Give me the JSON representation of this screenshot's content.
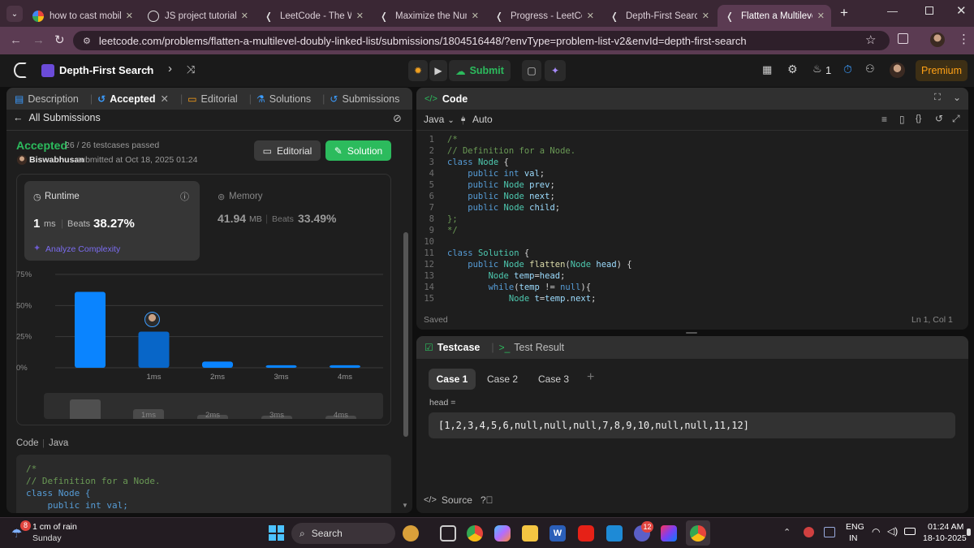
{
  "browser": {
    "tabs": [
      {
        "title": "how to cast mobile sc",
        "favicon": "google-icon"
      },
      {
        "title": "JS project tutorial",
        "favicon": "chatgpt-icon"
      },
      {
        "title": "LeetCode - The World",
        "favicon": "leetcode-icon"
      },
      {
        "title": "Maximize the Numbe",
        "favicon": "leetcode-icon"
      },
      {
        "title": "Progress - LeetCode",
        "favicon": "leetcode-icon"
      },
      {
        "title": "Depth-First Search -",
        "favicon": "leetcode-icon"
      },
      {
        "title": "Flatten a Multilevel D",
        "favicon": "leetcode-icon",
        "active": true
      }
    ],
    "url": "leetcode.com/problems/flatten-a-multilevel-doubly-linked-list/submissions/1804516448/?envType=problem-list-v2&envId=depth-first-search"
  },
  "nav": {
    "list_title": "Depth-First Search",
    "submit_label": "Submit",
    "streak": "1",
    "premium_label": "Premium"
  },
  "left_panel": {
    "tabs": [
      "Description",
      "Accepted",
      "Editorial",
      "Solutions",
      "Submissions"
    ],
    "back_label": "All Submissions",
    "status": "Accepted",
    "testcases": "26 / 26 testcases passed",
    "user": "Biswabhusan",
    "submitted": "submitted at Oct 18, 2025 01:24",
    "editorial_btn": "Editorial",
    "solution_btn": "Solution",
    "runtime_label": "Runtime",
    "runtime_value": "1",
    "runtime_unit": "ms",
    "beats_label": "Beats",
    "runtime_beats": "38.27%",
    "analyze_label": "Analyze Complexity",
    "memory_label": "Memory",
    "memory_value": "41.94",
    "memory_unit": "MB",
    "memory_beats": "33.49%",
    "code_label": "Code",
    "lang_label": "Java",
    "code_preview": [
      "/*",
      "// Definition for a Node.",
      "class Node {",
      "    public int val;"
    ]
  },
  "chart_data": {
    "type": "bar",
    "categories": [
      "",
      "1ms",
      "2ms",
      "3ms",
      "4ms"
    ],
    "values": [
      61,
      29,
      5,
      2,
      2
    ],
    "ylim": [
      0,
      75
    ],
    "yticks": [
      "0%",
      "25%",
      "50%",
      "75%"
    ],
    "highlight_index": 1,
    "colors": {
      "bar": "#0a84ff",
      "highlight": "#0866c8"
    }
  },
  "editor": {
    "title": "Code",
    "lang": "Java",
    "mode": "Auto",
    "saved": "Saved",
    "cursor": "Ln 1, Col 1"
  },
  "testcase": {
    "title": "Testcase",
    "result_tab": "Test Result",
    "cases": [
      "Case 1",
      "Case 2",
      "Case 3"
    ],
    "param_label": "head =",
    "param_value": "[1,2,3,4,5,6,null,null,null,7,8,9,10,null,null,11,12]",
    "source_label": "Source"
  },
  "taskbar": {
    "weather": "1 cm of rain",
    "day": "Sunday",
    "weather_badge": "8",
    "search": "Search",
    "teams_badge": "12",
    "lang": "ENG",
    "region": "IN",
    "time": "01:24 AM",
    "date": "18-10-2025"
  }
}
